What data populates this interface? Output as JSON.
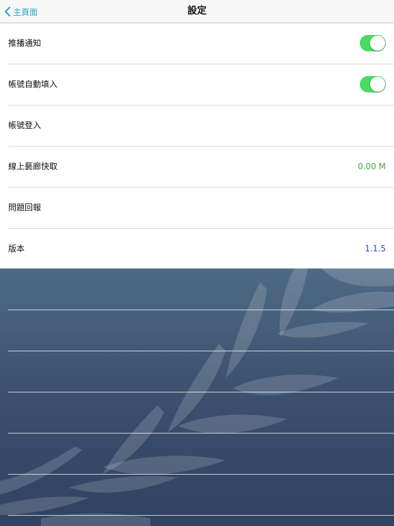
{
  "navbar": {
    "back_label": "主頁面",
    "title": "設定"
  },
  "settings": {
    "push_notifications": {
      "label": "推播通知",
      "enabled": true
    },
    "auto_fill_account": {
      "label": "帳號自動填入",
      "enabled": true
    },
    "account_login": {
      "label": "帳號登入"
    },
    "online_gallery_cache": {
      "label": "線上藝廊快取",
      "value": "0.00 M"
    },
    "feedback": {
      "label": "問題回報"
    },
    "version": {
      "label": "版本",
      "value": "1.1.5"
    }
  },
  "colors": {
    "accent": "#2aa7c9",
    "toggle_on": "#4cd964",
    "cache_value": "#3aa935",
    "version_value": "#2a3fd6"
  }
}
